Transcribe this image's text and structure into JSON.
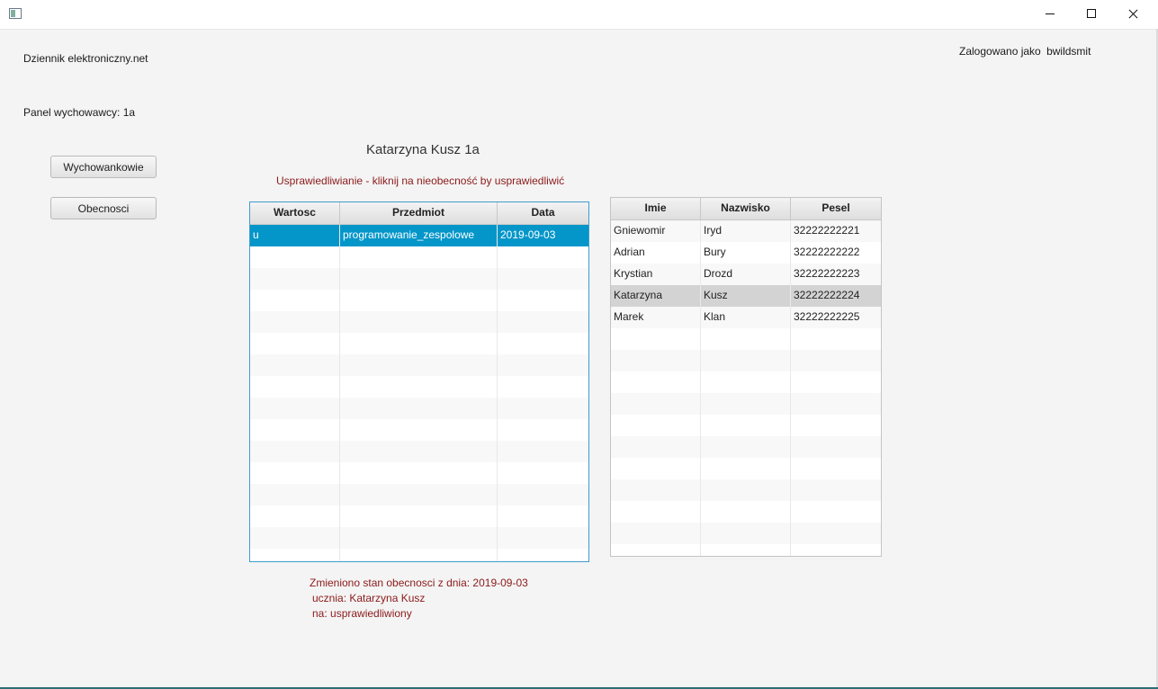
{
  "window": {
    "buttons": {
      "minimize": "minimize-icon",
      "maximize": "maximize-icon",
      "close": "close-icon"
    }
  },
  "header": {
    "app_name": "Dziennik elektroniczny.net",
    "logged_in_label": "Zalogowano jako",
    "username": "bwildsmit"
  },
  "panel": {
    "label": "Panel wychowawcy:",
    "class_name": "1a"
  },
  "nav": {
    "wychowankowie": "Wychowankowie",
    "obecnosci": "Obecnosci"
  },
  "student_title": "Katarzyna Kusz 1a",
  "instruction": "Usprawiedliwianie - kliknij na nieobecność by usprawiedliwić",
  "absences_table": {
    "columns": [
      "Wartosc",
      "Przedmiot",
      "Data"
    ],
    "rows": [
      [
        "u",
        "programowanie_zespolowe",
        "2019-09-03"
      ]
    ],
    "selected_row": 0,
    "empty_rows": 15
  },
  "students_table": {
    "columns": [
      "Imie",
      "Nazwisko",
      "Pesel"
    ],
    "rows": [
      [
        "Gniewomir",
        "Iryd",
        "32222222221"
      ],
      [
        "Adrian",
        "Bury",
        "32222222222"
      ],
      [
        "Krystian",
        "Drozd",
        "32222222223"
      ],
      [
        "Katarzyna",
        "Kusz",
        "32222222224"
      ],
      [
        "Marek",
        "Klan",
        "32222222225"
      ]
    ],
    "highlighted_row": 3,
    "empty_rows": 11
  },
  "status_message": {
    "line1": "Zmieniono stan obecnosci z dnia: 2019-09-03",
    "line2": "ucznia: Katarzyna Kusz",
    "line3": "na: usprawiedliwiony"
  },
  "colors": {
    "selection": "#0496c9",
    "table_focus_border": "#3f9ccf",
    "message_red": "#8b1a1a",
    "row_highlight": "#d3d3d3"
  }
}
